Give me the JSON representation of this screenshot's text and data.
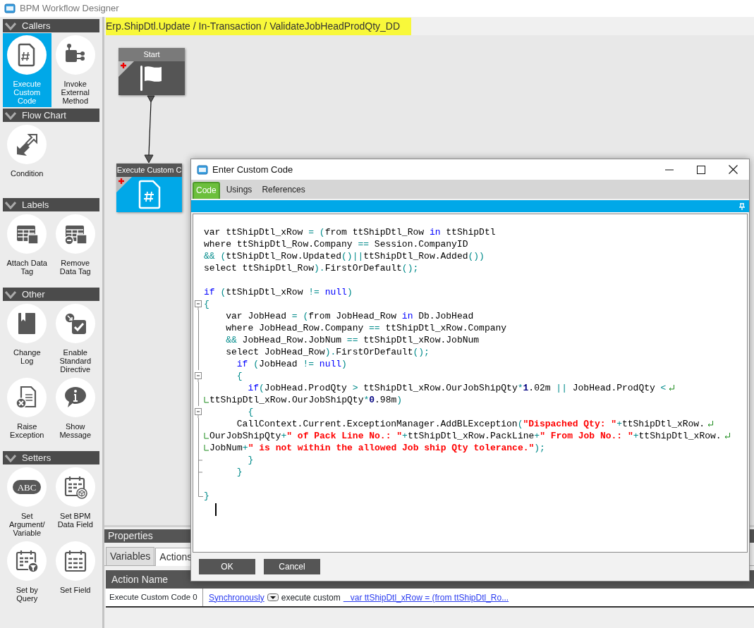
{
  "window": {
    "title": "BPM Workflow Designer"
  },
  "sidebar": {
    "groups": [
      {
        "title": "Callers",
        "expanded": true,
        "items": [
          {
            "label": "Execute Custom Code",
            "selected": true
          },
          {
            "label": "Invoke External Method",
            "selected": false
          }
        ]
      },
      {
        "title": "Flow Chart",
        "expanded": true,
        "items": [
          {
            "label": "Condition",
            "selected": false
          }
        ]
      },
      {
        "title": "Labels",
        "expanded": true,
        "items": [
          {
            "label": "Attach Data Tag",
            "selected": false
          },
          {
            "label": "Remove Data Tag",
            "selected": false
          }
        ]
      },
      {
        "title": "Other",
        "expanded": true,
        "items": [
          {
            "label": "Change Log",
            "selected": false
          },
          {
            "label": "Enable Standard Directive",
            "selected": false
          },
          {
            "label": "Raise Exception",
            "selected": false
          },
          {
            "label": "Show Message",
            "selected": false
          }
        ]
      },
      {
        "title": "Setters",
        "expanded": true,
        "items": [
          {
            "label": "Set Argument/ Variable",
            "selected": false,
            "icon_text": "ABC"
          },
          {
            "label": "Set BPM Data Field",
            "selected": false
          },
          {
            "label": "Set by Query",
            "selected": false
          },
          {
            "label": "Set Field",
            "selected": false
          }
        ]
      }
    ]
  },
  "breadcrumb": "Erp.ShipDtl.Update / In-Transaction / ValidateJobHeadProdQty_DD",
  "canvas": {
    "nodes": [
      {
        "title": "Start",
        "kind": "start"
      },
      {
        "title": "Execute Custom C",
        "kind": "custom-code"
      }
    ]
  },
  "properties": {
    "title": "Properties",
    "tabs": [
      {
        "label": "Variables",
        "selected": false
      },
      {
        "label": "Actions",
        "selected": true
      }
    ],
    "columns": [
      "Action Name"
    ],
    "rows": [
      {
        "name": "Execute Custom Code 0",
        "mode": "Synchronously",
        "verb": "execute custom",
        "code_link": "   var ttShipDtl_xRow = (from ttShipDtl_Ro..."
      }
    ]
  },
  "dialog": {
    "title": "Enter Custom Code",
    "tabs": [
      {
        "label": "Code",
        "selected": true
      },
      {
        "label": "Usings",
        "selected": false
      },
      {
        "label": "References",
        "selected": false
      }
    ],
    "code_lines": [
      {
        "kind": "plain",
        "segments": [
          {
            "kind": "text",
            "text": "var ttShipDtl_xRow "
          },
          {
            "kind": "op",
            "text": "= ("
          },
          {
            "kind": "text",
            "text": "from ttShipDtl_Row "
          },
          {
            "kind": "keyword",
            "text": "in"
          },
          {
            "kind": "text",
            "text": " ttShipDtl"
          }
        ]
      },
      {
        "kind": "plain",
        "segments": [
          {
            "kind": "text",
            "text": "where ttShipDtl_Row.Company "
          },
          {
            "kind": "op",
            "text": "=="
          },
          {
            "kind": "text",
            "text": " Session.CompanyID"
          }
        ]
      },
      {
        "kind": "plain",
        "segments": [
          {
            "kind": "op",
            "text": "&& ("
          },
          {
            "kind": "text",
            "text": "ttShipDtl_Row.Updated"
          },
          {
            "kind": "op",
            "text": "()||"
          },
          {
            "kind": "text",
            "text": "ttShipDtl_Row.Added"
          },
          {
            "kind": "op",
            "text": "())"
          }
        ]
      },
      {
        "kind": "plain",
        "segments": [
          {
            "kind": "text",
            "text": "select ttShipDtl_Row"
          },
          {
            "kind": "op",
            "text": ")."
          },
          {
            "kind": "text",
            "text": "FirstOrDefault"
          },
          {
            "kind": "op",
            "text": "();"
          }
        ]
      },
      {
        "kind": "blank"
      },
      {
        "kind": "plain",
        "segments": [
          {
            "kind": "keyword",
            "text": "if"
          },
          {
            "kind": "op",
            "text": " ("
          },
          {
            "kind": "text",
            "text": "ttShipDtl_xRow "
          },
          {
            "kind": "op",
            "text": "!= "
          },
          {
            "kind": "keyword",
            "text": "null"
          },
          {
            "kind": "op",
            "text": ")"
          }
        ]
      },
      {
        "kind": "fold-open",
        "segments": [
          {
            "kind": "op",
            "text": "{"
          }
        ]
      },
      {
        "kind": "fold-bar",
        "segments": [
          {
            "kind": "text",
            "text": "    var JobHead "
          },
          {
            "kind": "op",
            "text": "= ("
          },
          {
            "kind": "text",
            "text": "from JobHead_Row "
          },
          {
            "kind": "keyword",
            "text": "in"
          },
          {
            "kind": "text",
            "text": " Db.JobHead"
          }
        ]
      },
      {
        "kind": "fold-bar",
        "segments": [
          {
            "kind": "text",
            "text": "    where JobHead_Row.Company "
          },
          {
            "kind": "op",
            "text": "=="
          },
          {
            "kind": "text",
            "text": " ttShipDtl_xRow.Company"
          }
        ]
      },
      {
        "kind": "fold-bar",
        "segments": [
          {
            "kind": "op",
            "text": "    &&"
          },
          {
            "kind": "text",
            "text": " JobHead_Row.JobNum "
          },
          {
            "kind": "op",
            "text": "=="
          },
          {
            "kind": "text",
            "text": " ttShipDtl_xRow.JobNum"
          }
        ]
      },
      {
        "kind": "fold-bar",
        "segments": [
          {
            "kind": "text",
            "text": "    select JobHead_Row"
          },
          {
            "kind": "op",
            "text": ")."
          },
          {
            "kind": "text",
            "text": "FirstOrDefault"
          },
          {
            "kind": "op",
            "text": "();"
          }
        ]
      },
      {
        "kind": "fold-bar",
        "segments": [
          {
            "kind": "keyword",
            "text": "      if"
          },
          {
            "kind": "op",
            "text": " ("
          },
          {
            "kind": "text",
            "text": "JobHead "
          },
          {
            "kind": "op",
            "text": "!= "
          },
          {
            "kind": "keyword",
            "text": "null"
          },
          {
            "kind": "op",
            "text": ")"
          }
        ]
      },
      {
        "kind": "fold-open",
        "segments": [
          {
            "kind": "op",
            "text": "      {"
          }
        ]
      },
      {
        "kind": "fold-bar",
        "wrap_end": true,
        "segments": [
          {
            "kind": "keyword",
            "text": "        if"
          },
          {
            "kind": "op",
            "text": "("
          },
          {
            "kind": "text",
            "text": "JobHead.ProdQty "
          },
          {
            "kind": "op",
            "text": ">"
          },
          {
            "kind": "text",
            "text": " ttShipDtl_xRow.OurJobShipQty"
          },
          {
            "kind": "op",
            "text": "*"
          },
          {
            "kind": "number",
            "text": "1"
          },
          {
            "kind": "text",
            "text": ".02m "
          },
          {
            "kind": "op",
            "text": "||"
          },
          {
            "kind": "text",
            "text": " JobHead.ProdQty "
          },
          {
            "kind": "op",
            "text": "<"
          }
        ]
      },
      {
        "kind": "fold-bar",
        "wrap_start": true,
        "segments": [
          {
            "kind": "text",
            "text": "ttShipDtl_xRow.OurJobShipQty"
          },
          {
            "kind": "op",
            "text": "*"
          },
          {
            "kind": "number",
            "text": "0"
          },
          {
            "kind": "text",
            "text": ".98m"
          },
          {
            "kind": "op",
            "text": ")"
          }
        ]
      },
      {
        "kind": "fold-open",
        "segments": [
          {
            "kind": "op",
            "text": "        {"
          }
        ]
      },
      {
        "kind": "fold-bar",
        "wrap_end": true,
        "segments": [
          {
            "kind": "text",
            "text": "      CallContext.Current.ExceptionManager.AddBLException"
          },
          {
            "kind": "op",
            "text": "("
          },
          {
            "kind": "string",
            "text": "\"Dispached Qty: \""
          },
          {
            "kind": "op",
            "text": "+"
          },
          {
            "kind": "text",
            "text": "ttShipDtl_xRow."
          }
        ]
      },
      {
        "kind": "fold-bar",
        "wrap_start": true,
        "wrap_end": true,
        "segments": [
          {
            "kind": "text",
            "text": "OurJobShipQty"
          },
          {
            "kind": "op",
            "text": "+"
          },
          {
            "kind": "string",
            "text": "\" of Pack Line No.: \""
          },
          {
            "kind": "op",
            "text": "+"
          },
          {
            "kind": "text",
            "text": "ttShipDtl_xRow.PackLine"
          },
          {
            "kind": "op",
            "text": "+"
          },
          {
            "kind": "string",
            "text": "\" From Job No.: \""
          },
          {
            "kind": "op",
            "text": "+"
          },
          {
            "kind": "text",
            "text": "ttShipDtl_xRow."
          }
        ]
      },
      {
        "kind": "fold-bar",
        "wrap_start": true,
        "segments": [
          {
            "kind": "text",
            "text": "JobNum"
          },
          {
            "kind": "op",
            "text": "+"
          },
          {
            "kind": "string",
            "text": "\" is not within the allowed Job ship Qty tolerance.\""
          },
          {
            "kind": "op",
            "text": ");"
          }
        ]
      },
      {
        "kind": "fold-branch",
        "segments": [
          {
            "kind": "op",
            "text": "        }"
          }
        ]
      },
      {
        "kind": "fold-branch",
        "segments": [
          {
            "kind": "op",
            "text": "      }"
          }
        ]
      },
      {
        "kind": "fold-bar"
      },
      {
        "kind": "fold-end",
        "segments": [
          {
            "kind": "op",
            "text": "}"
          }
        ]
      }
    ],
    "buttons": [
      "OK",
      "Cancel"
    ]
  }
}
